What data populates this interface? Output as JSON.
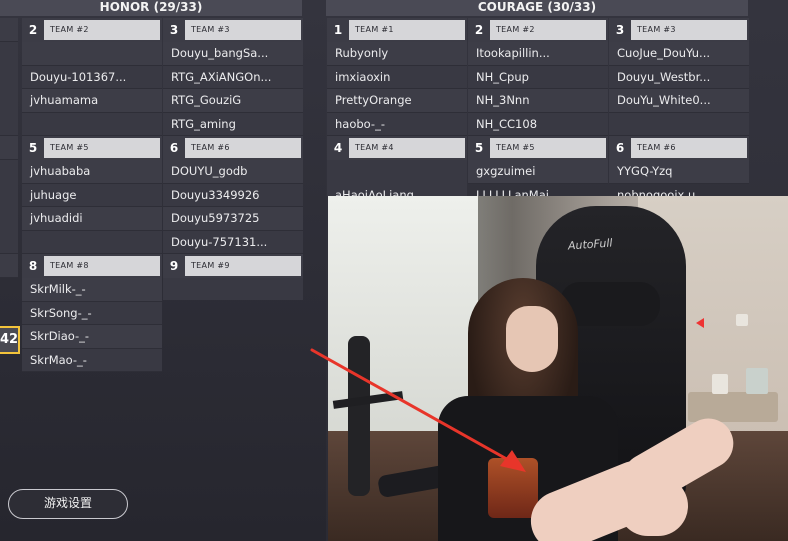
{
  "honor": {
    "title": "HONOR (29/33)",
    "teams": [
      {
        "num": "2",
        "tag": "TEAM #2",
        "players": [
          "",
          "Douyu-101367...",
          "jvhuamama",
          ""
        ]
      },
      {
        "num": "3",
        "tag": "TEAM #3",
        "players": [
          "Douyu_bangSa...",
          "RTG_AXiANGOn...",
          "RTG_GouziG",
          "RTG_aming"
        ]
      },
      {
        "num": "5",
        "tag": "TEAM #5",
        "players": [
          "jvhuababa",
          "juhuage",
          "jvhuadidi",
          ""
        ]
      },
      {
        "num": "6",
        "tag": "TEAM #6",
        "players": [
          "DOUYU_godb",
          "Douyu3349926",
          "Douyu5973725",
          "Douyu-757131..."
        ]
      },
      {
        "num": "8",
        "tag": "TEAM #8",
        "players": [
          "SkrMilk-_-",
          "SkrSong-_-",
          "SkrDiao-_-",
          "SkrMao-_-"
        ]
      },
      {
        "num": "9",
        "tag": "TEAM #9",
        "players": []
      }
    ],
    "score_badge": "42"
  },
  "courage": {
    "title": "COURAGE (30/33)",
    "teams": [
      {
        "num": "1",
        "tag": "TEAM #1",
        "players": [
          "Rubyonly",
          "imxiaoxin",
          "PrettyOrange",
          "haobo-_-"
        ]
      },
      {
        "num": "2",
        "tag": "TEAM #2",
        "players": [
          "Itookapillin...",
          "NH_Cpup",
          "NH_3Nnn",
          "NH_CC108"
        ]
      },
      {
        "num": "3",
        "tag": "TEAM #3",
        "players": [
          "CuoJue_DouYu...",
          "Douyu_Westbr...",
          "DouYu_White0...",
          ""
        ]
      },
      {
        "num": "4",
        "tag": "TEAM #4",
        "players": []
      },
      {
        "num": "5",
        "tag": "TEAM #5",
        "players": [
          "gxgzuimei"
        ]
      },
      {
        "num": "6",
        "tag": "TEAM #6",
        "players": [
          "YYGQ-Yzq"
        ]
      }
    ],
    "partial_players": [
      "aHaoiAoLiang",
      "LLLLLLanMai",
      "nobnogooix.u..."
    ]
  },
  "settings_button": "游戏设置",
  "webcam": {
    "chair_brand": "AutoFull"
  },
  "colors": {
    "accent_yellow": "#f3c43b",
    "arrow_red": "#e8352a",
    "panel": "#3d3d47",
    "tag_bg": "#d6d6d9"
  }
}
